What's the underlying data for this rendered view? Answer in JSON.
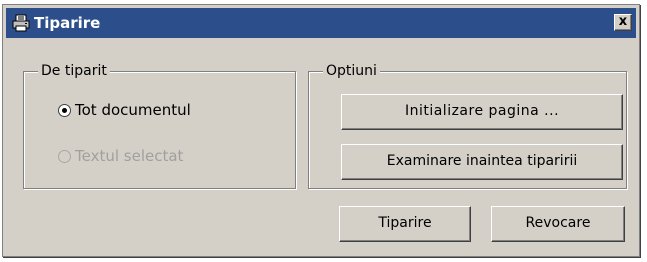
{
  "window": {
    "title": "Tiparire",
    "title_icon": "printer-icon",
    "close_label": "x"
  },
  "print_range": {
    "legend": "De tiparit",
    "options": [
      {
        "label": "Tot documentul",
        "selected": true,
        "enabled": true
      },
      {
        "label": "Textul selectat",
        "selected": false,
        "enabled": false
      }
    ]
  },
  "options_group": {
    "legend": "Optiuni",
    "page_setup_label": "Initializare pagina ...",
    "print_preview_label": "Examinare inaintea tiparirii"
  },
  "footer": {
    "print_label": "Tiparire",
    "cancel_label": "Revocare"
  },
  "colors": {
    "titlebar": "#2c4f8c",
    "dialog_face": "#d4d0c8",
    "disabled_text": "#a0a0a0"
  }
}
